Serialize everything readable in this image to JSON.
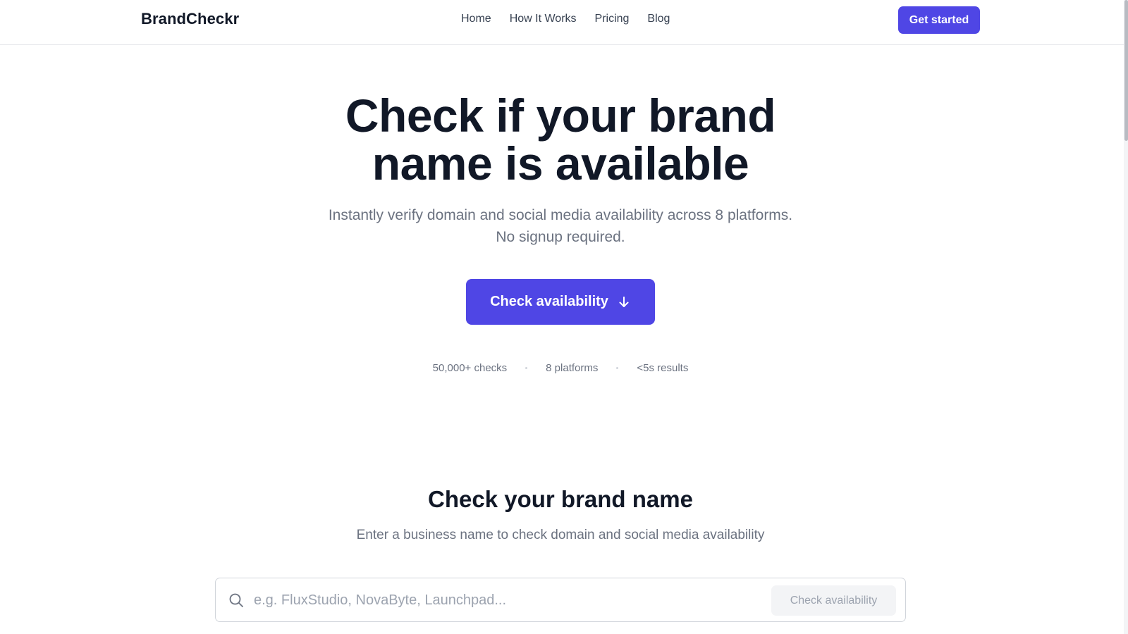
{
  "header": {
    "logo": "BrandCheckr",
    "nav": [
      "Home",
      "How It Works",
      "Pricing",
      "Blog"
    ],
    "cta_label": "Get started"
  },
  "hero": {
    "title_line1": "Check if your brand",
    "title_line2": "name is available",
    "subtitle_line1": "Instantly verify domain and social media availability across 8 platforms.",
    "subtitle_line2": "No signup required.",
    "cta_label": "Check availability",
    "cta_icon": "arrow-down-icon",
    "stats": [
      "50,000+ checks",
      "8 platforms",
      "<5s results"
    ]
  },
  "check_section": {
    "title": "Check your brand name",
    "subtitle": "Enter a business name to check domain and social media availability",
    "search_placeholder": "e.g. FluxStudio, NovaByte, Launchpad...",
    "search_value": "",
    "button_label": "Check  availability",
    "search_icon": "search-icon"
  },
  "colors": {
    "accent": "#4f46e5",
    "text": "#111827",
    "muted": "#6b7280",
    "border": "#e5e7eb"
  }
}
